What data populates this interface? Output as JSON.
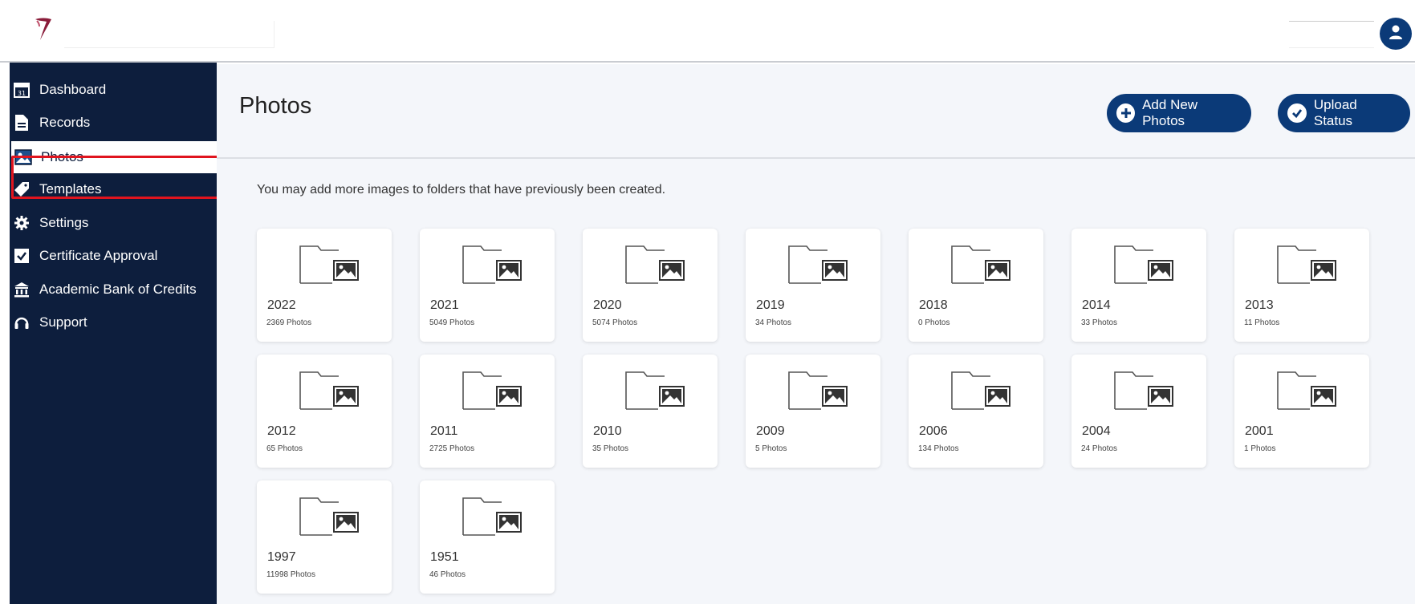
{
  "topbar": {
    "logo_icon": "brand-logo-icon",
    "avatar_icon": "user-icon",
    "colors": {
      "avatar": "#0b3a78"
    }
  },
  "sidebar": {
    "items": [
      {
        "label": "Dashboard",
        "icon": "calendar-icon"
      },
      {
        "label": "Records",
        "icon": "document-icon"
      },
      {
        "label": "Photos",
        "icon": "image-icon",
        "active": true
      },
      {
        "label": "Templates",
        "icon": "tag-icon"
      },
      {
        "label": "Settings",
        "icon": "gear-icon"
      },
      {
        "label": "Certificate Approval",
        "icon": "checkbox-icon"
      },
      {
        "label": "Academic Bank of Credits",
        "icon": "bank-icon"
      },
      {
        "label": "Support",
        "icon": "headset-icon"
      }
    ],
    "colors": {
      "background": "#0d1e3d",
      "highlight_outline": "#e0141e"
    }
  },
  "header": {
    "title": "Photos",
    "add_button": {
      "label": "Add New Photos",
      "icon": "plus-circle-icon"
    },
    "upload_button": {
      "label": "Upload Status",
      "icon": "check-circle-icon"
    },
    "colors": {
      "button": "#0b3a78"
    }
  },
  "main": {
    "info_text": "You may add more images to folders that have previously been created.",
    "folder_icon": "folder-image-icon",
    "folders": [
      {
        "name": "2022",
        "count": "2369 Photos"
      },
      {
        "name": "2021",
        "count": "5049 Photos"
      },
      {
        "name": "2020",
        "count": "5074 Photos"
      },
      {
        "name": "2019",
        "count": "34 Photos"
      },
      {
        "name": "2018",
        "count": "0 Photos"
      },
      {
        "name": "2014",
        "count": "33 Photos"
      },
      {
        "name": "2013",
        "count": "11 Photos"
      },
      {
        "name": "2012",
        "count": "65 Photos"
      },
      {
        "name": "2011",
        "count": "2725 Photos"
      },
      {
        "name": "2010",
        "count": "35 Photos"
      },
      {
        "name": "2009",
        "count": "5 Photos"
      },
      {
        "name": "2006",
        "count": "134 Photos"
      },
      {
        "name": "2004",
        "count": "24 Photos"
      },
      {
        "name": "2001",
        "count": "1 Photos"
      },
      {
        "name": "1997",
        "count": "11998 Photos"
      },
      {
        "name": "1951",
        "count": "46 Photos"
      }
    ]
  }
}
